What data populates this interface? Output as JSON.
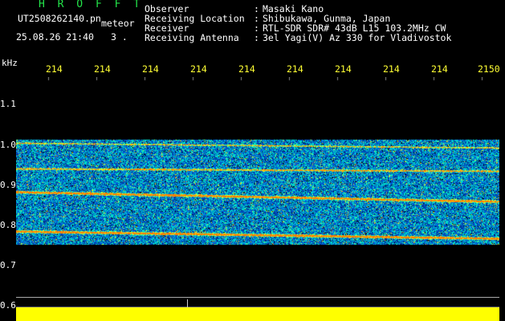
{
  "header": {
    "title": "H R O F F T",
    "filename": "UT2508262140.pn",
    "tag": "meteor",
    "date": "25.08.26 21:40",
    "rate": "3 ."
  },
  "info": [
    {
      "label": "Observer",
      "value": "Masaki Kano"
    },
    {
      "label": "Receiving Location",
      "value": "Shibukawa, Gunma, Japan"
    },
    {
      "label": "Receiver",
      "value": "RTL-SDR SDR# 43dB L15 103.2MHz CW"
    },
    {
      "label": "Receiving Antenna",
      "value": "3el Yagi(V) Az 330 for Vladivostok"
    }
  ],
  "y_unit": "kHz",
  "y_ticks": [
    "1.1",
    "1.0",
    "0.9",
    "0.8",
    "0.7",
    "0.6"
  ],
  "x_ticks": [
    "214",
    "214",
    "214",
    "214",
    "214",
    "214",
    "214",
    "214",
    "214",
    "2150"
  ],
  "colors": {
    "background": "#000000",
    "title": "#23e54a",
    "tick_labels": "#ffff33",
    "noise_bar": "#ffff00"
  }
}
